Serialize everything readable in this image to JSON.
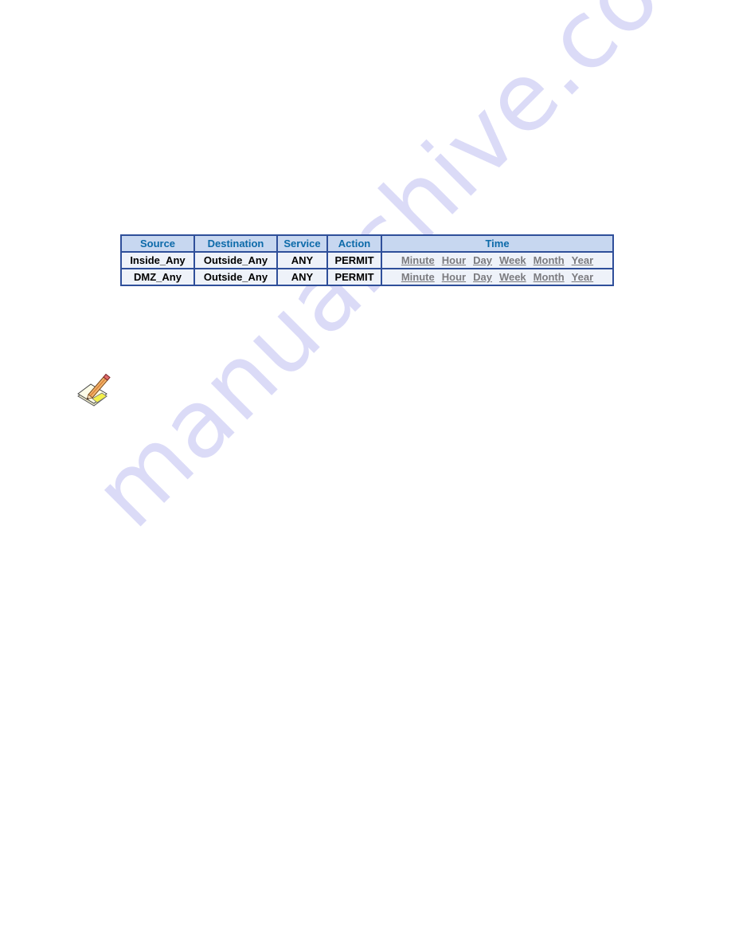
{
  "policy_table": {
    "headers": {
      "source": "Source",
      "destination": "Destination",
      "service": "Service",
      "action": "Action",
      "time": "Time"
    },
    "rows": [
      {
        "source": "Inside_Any",
        "destination": "Outside_Any",
        "service": "ANY",
        "action": "PERMIT",
        "time_links": [
          "Minute",
          "Hour",
          "Day",
          "Week",
          "Month",
          "Year"
        ]
      },
      {
        "source": "DMZ_Any",
        "destination": "Outside_Any",
        "service": "ANY",
        "action": "PERMIT",
        "time_links": [
          "Minute",
          "Hour",
          "Day",
          "Week",
          "Month",
          "Year"
        ]
      }
    ]
  },
  "note_icon": "note-pencil-icon",
  "watermark": "manualshive.com",
  "colors": {
    "table_border": "#2f4f9a",
    "header_bg": "#c7d7f0",
    "header_text": "#0c6aa9",
    "row_bg": "#eef2f9",
    "time_link": "#7b7b7f",
    "watermark": "#d8d8f7"
  }
}
